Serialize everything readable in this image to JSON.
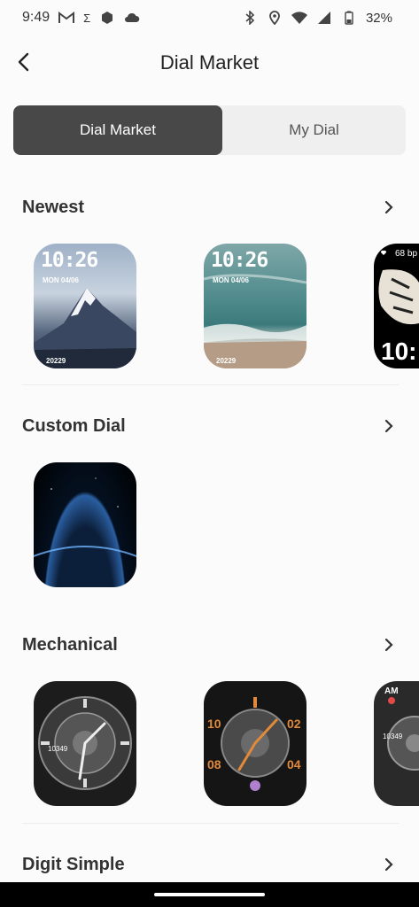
{
  "status": {
    "time": "9:49",
    "sigma": "Σ",
    "battery": "32%"
  },
  "header": {
    "title": "Dial Market"
  },
  "tabs": [
    {
      "label": "Dial Market"
    },
    {
      "label": "My Dial"
    }
  ],
  "sections": [
    {
      "title": "Newest",
      "dials": [
        {
          "time": "10:26",
          "date": "MON   04/06",
          "steps": "20229",
          "theme": "mountain"
        },
        {
          "time": "10:26",
          "date": "MON   04/06",
          "steps": "20229",
          "theme": "ocean"
        },
        {
          "bpm": "68 bp",
          "time": "10:",
          "theme": "butterfly"
        }
      ]
    },
    {
      "title": "Custom Dial",
      "dials": [
        {
          "theme": "space"
        }
      ]
    },
    {
      "title": "Mechanical",
      "dials": [
        {
          "steps": "10349",
          "theme": "mech-silver"
        },
        {
          "theme": "mech-orange",
          "numbers": [
            "10",
            "02",
            "08",
            "04"
          ]
        },
        {
          "theme": "mech-ampm",
          "ampm": "AM",
          "steps": "10349"
        }
      ]
    },
    {
      "title": "Digit Simple",
      "dials": []
    }
  ],
  "colors": {
    "accent": "#484848",
    "orange": "#e08a3a"
  }
}
